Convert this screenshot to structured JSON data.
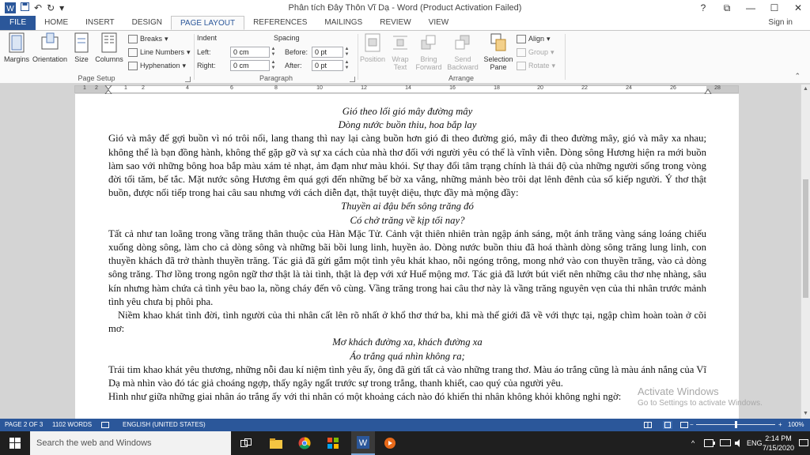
{
  "window": {
    "title": "Phân tích Đây Thôn Vĩ Dạ - Word (Product Activation Failed)",
    "help": "?",
    "restore": "⧉",
    "minimize": "—",
    "maximize": "☐",
    "close": "✕",
    "qat_undo": "↶",
    "qat_redo": "↻",
    "qat_more": "▾"
  },
  "tabs": [
    "FILE",
    "HOME",
    "INSERT",
    "DESIGN",
    "PAGE LAYOUT",
    "REFERENCES",
    "MAILINGS",
    "REVIEW",
    "VIEW"
  ],
  "signin": "Sign in",
  "ribbon": {
    "page_setup": {
      "label": "Page Setup",
      "margins": "Margins",
      "orientation": "Orientation",
      "size": "Size",
      "columns": "Columns",
      "breaks": "Breaks",
      "line_numbers": "Line Numbers",
      "hyphenation": "Hyphenation"
    },
    "paragraph": {
      "label": "Paragraph",
      "indent_label": "Indent",
      "spacing_label": "Spacing",
      "left_label": "Left:",
      "left_value": "0 cm",
      "right_label": "Right:",
      "right_value": "0 cm",
      "before_label": "Before:",
      "before_value": "0 pt",
      "after_label": "After:",
      "after_value": "0 pt"
    },
    "arrange": {
      "label": "Arrange",
      "position": "Position",
      "wrap_text_1": "Wrap",
      "wrap_text_2": "Text",
      "bring_forward_1": "Bring",
      "bring_forward_2": "Forward",
      "send_backward_1": "Send",
      "send_backward_2": "Backward",
      "selection_pane_1": "Selection",
      "selection_pane_2": "Pane",
      "align": "Align",
      "group": "Group",
      "rotate": "Rotate"
    }
  },
  "ruler": {
    "labels": [
      "1",
      "2",
      "1",
      "2",
      "4",
      "6",
      "8",
      "10",
      "12",
      "14",
      "16",
      "18",
      "20",
      "22",
      "24",
      "26",
      "28"
    ]
  },
  "document": {
    "p1_verse1": "Gió theo lối gió mây đường mây",
    "p1_verse2": "Dòng nước buồn thiu, hoa bắp lay",
    "p1_body": "Gió và mây để gợi buồn vì nó trôi nổi, lang thang thì nay lại càng buồn hơn gió đi theo đường gió, mây đi theo đường mây, gió và mây xa nhau; không thể là bạn đồng hành, không thể gặp gỡ và sự xa cách của nhà thơ đối với người yêu có thể là vĩnh viễn. Dòng sông Hương hiện ra mới buồn làm sao với những bông hoa bắp màu xám tẻ nhạt, ảm đạm như màu khói. Sự thay đổi tâm trạng chính là thái độ của những người sống trong vòng đời tối tăm, bế tắc. Mặt nước sông Hương êm quá gợi đến những bế bờ xa vắng, những mảnh bèo trôi dạt lênh đênh của số kiếp người. Ý thơ thật buồn, được nối tiếp trong hai câu sau nhưng với cách diễn đạt, thật tuyệt diệu, thực đầy mà mộng đầy:",
    "p2_verse1": "Thuyền ai đậu bến sông trăng đó",
    "p2_verse2": "Có chở trăng về kịp tối nay?",
    "p2_body": "Tất cả như tan loãng trong vầng trăng thân thuộc của Hàn Mặc Tử. Cảnh vật thiên nhiên tràn ngập ánh sáng, một ánh trăng vàng sáng loáng chiếu xuống dòng sông, làm cho cả dòng sông và những bãi bồi lung linh, huyền ảo. Dòng nước buồn thiu đã hoá thành dòng sông trăng lung linh, con thuyền khách đã trở thành thuyền trăng. Tác giả đã gửi gắm một tình yêu khát khao, nỗi ngóng trông, mong nhớ vào con thuyền trăng, vào cả dòng sông trăng. Thơ lồng trong ngôn ngữ thơ thật là tài tình, thật là đẹp với xứ Huế mộng mơ. Tác giả đã lướt bút viết nên những câu thơ nhẹ nhàng, sâu kín nhưng hàm chứa cả tình yêu bao la, nồng cháy đến vô cùng. Vầng trăng trong hai câu thơ này là vầng trăng nguyên vẹn của thi nhân trước mảnh tình yêu chưa bị phôi pha.",
    "p3_body": "Niềm khao khát tình đời, tình người của thi nhân cất lên rõ nhất ở khổ thơ thứ ba, khi mà thế giới đã về với thực tại, ngập chìm hoàn toàn ở cõi mơ:",
    "p4_verse1": "Mơ khách đường xa, khách đường xa",
    "p4_verse2": "Áo trắng quá nhìn không ra;",
    "p4_body": "Trái tim khao khát yêu thương, những nỗi đau kí niệm tình yêu ấy, ông đã gửi tất cả vào những trang thơ. Màu áo trắng cũng là màu ánh nắng của Vĩ Dạ mà nhìn vào đó tác giả choáng ngợp, thấy ngây ngất trước sự trong trắng, thanh khiết, cao quý của người yêu.",
    "p5_body": "Hình như giữa những giai nhân áo trắng ấy với thi nhân có một khoảng cách nào đó khiến thi nhân không khỏi không nghi ngờ:"
  },
  "watermark": {
    "line1": "Activate Windows",
    "line2": "Go to Settings to activate Windows."
  },
  "status": {
    "page": "PAGE 2 OF 3",
    "words": "1102 WORDS",
    "language": "ENGLISH (UNITED STATES)",
    "zoom_minus": "−",
    "zoom_plus": "+",
    "zoom": "100%",
    "zoom_fraction": 0.5
  },
  "taskbar": {
    "search_placeholder": "Search the web and Windows",
    "lang": "ENG",
    "time": "2:14 PM",
    "date": "7/15/2020",
    "tray_up": "^"
  },
  "colors": {
    "accent": "#2b579a",
    "taskbar": "#1f1f1f"
  }
}
